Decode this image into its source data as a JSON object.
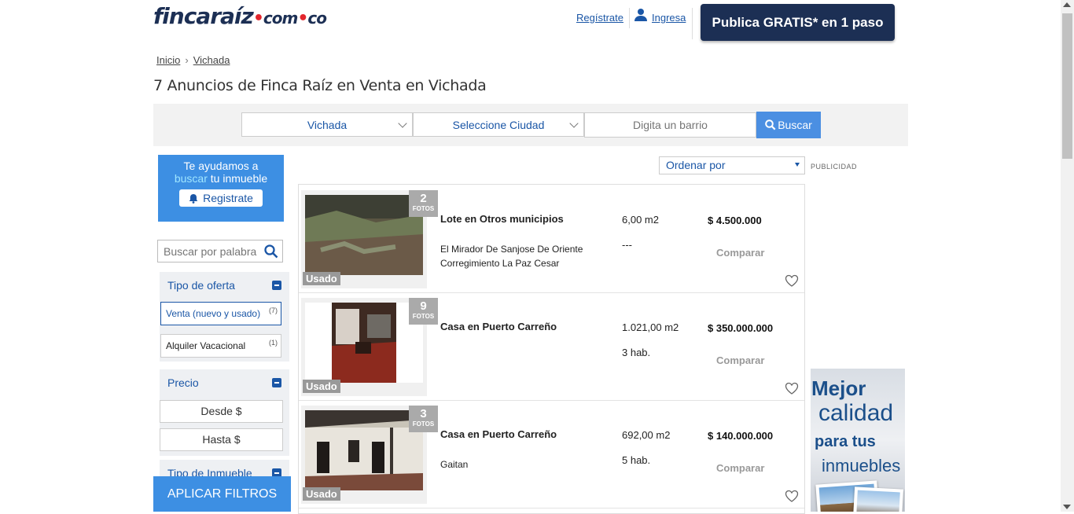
{
  "header": {
    "logo_main": "fincaraíz",
    "logo_suffix_com": "com",
    "logo_suffix_co": "co",
    "register_link": "Regístrate",
    "login_link": "Ingresa",
    "publish_button": "Publica GRATIS* en 1 paso"
  },
  "breadcrumb": {
    "home": "Inicio",
    "current": "Vichada"
  },
  "page_title": "7 Anuncios de Finca Raíz en Venta en Vichada",
  "search": {
    "department": "Vichada",
    "city": "Seleccione Ciudad",
    "neighborhood_placeholder": "Digita un barrio",
    "button": "Buscar"
  },
  "sidebar": {
    "help_line1": "Te ayudamos a",
    "help_highlight": "buscar",
    "help_line2": "tu inmueble",
    "help_button": "Registrate",
    "keyword_placeholder": "Buscar por palabra",
    "offer_type": {
      "title": "Tipo de oferta",
      "options": [
        {
          "label": "Venta (nuevo y usado)",
          "count": "(7)"
        },
        {
          "label": "Alquiler Vacacional",
          "count": "(1)"
        }
      ]
    },
    "price": {
      "title": "Precio",
      "from": "Desde $",
      "to": "Hasta $"
    },
    "property_type": {
      "title": "Tipo de Inmueble"
    },
    "apply_button": "APLICAR FILTROS"
  },
  "sort": {
    "label": "Ordenar por"
  },
  "ad_label": "PUBLICIDAD",
  "listings": [
    {
      "photos": "2",
      "photos_label": "FOTOS",
      "condition": "Usado",
      "title": "Lote en Otros municipios",
      "location": "El Mirador De Sanjose De Oriente Corregimiento La Paz Cesar",
      "area": "6,00 m2",
      "extra": "---",
      "price": "$ 4.500.000",
      "compare": "Comparar"
    },
    {
      "photos": "9",
      "photos_label": "FOTOS",
      "condition": "Usado",
      "title": "Casa en Puerto Carreño",
      "location": "",
      "area": "1.021,00 m2",
      "extra": "3 hab.",
      "price": "$ 350.000.000",
      "compare": "Comparar"
    },
    {
      "photos": "3",
      "photos_label": "FOTOS",
      "condition": "Usado",
      "title": "Casa en Puerto Carreño",
      "location": "Gaitan",
      "area": "692,00 m2",
      "extra": "5 hab.",
      "price": "$ 140.000.000",
      "compare": "Comparar"
    }
  ],
  "advert": {
    "line1": "Mejor",
    "line2": "calidad",
    "line3": "para tus",
    "line4": "inmuebles"
  },
  "colors": {
    "brand_navy": "#1c2f54",
    "accent_blue": "#3d8fe3",
    "link_blue": "#1a56a6",
    "logo_red": "#e3262d"
  }
}
